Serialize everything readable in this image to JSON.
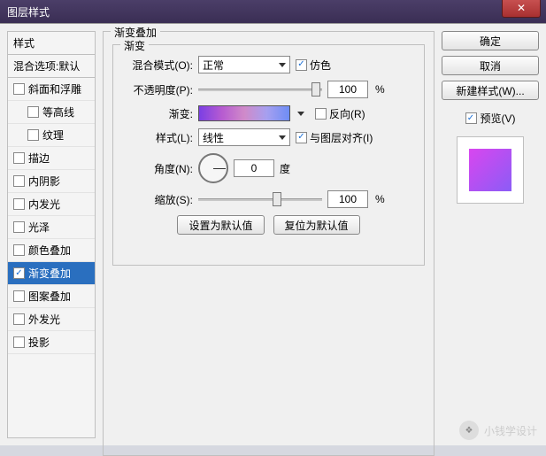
{
  "title": "图层样式",
  "sidebar": {
    "header": "样式",
    "blend": "混合选项:默认",
    "items": [
      {
        "label": "斜面和浮雕",
        "checked": false,
        "selected": false
      },
      {
        "label": "等高线",
        "checked": false,
        "selected": false,
        "indent": true
      },
      {
        "label": "纹理",
        "checked": false,
        "selected": false,
        "indent": true
      },
      {
        "label": "描边",
        "checked": false,
        "selected": false
      },
      {
        "label": "内阴影",
        "checked": false,
        "selected": false
      },
      {
        "label": "内发光",
        "checked": false,
        "selected": false
      },
      {
        "label": "光泽",
        "checked": false,
        "selected": false
      },
      {
        "label": "颜色叠加",
        "checked": false,
        "selected": false
      },
      {
        "label": "渐变叠加",
        "checked": true,
        "selected": true
      },
      {
        "label": "图案叠加",
        "checked": false,
        "selected": false
      },
      {
        "label": "外发光",
        "checked": false,
        "selected": false
      },
      {
        "label": "投影",
        "checked": false,
        "selected": false
      }
    ]
  },
  "main": {
    "group_title": "渐变叠加",
    "inner_title": "渐变",
    "blend_label": "混合模式(O):",
    "blend_value": "正常",
    "dither_label": "仿色",
    "dither_checked": true,
    "opacity_label": "不透明度(P):",
    "opacity_value": "100",
    "pct": "%",
    "gradient_label": "渐变:",
    "reverse_label": "反向(R)",
    "reverse_checked": false,
    "style_label": "样式(L):",
    "style_value": "线性",
    "align_label": "与图层对齐(I)",
    "align_checked": true,
    "angle_label": "角度(N):",
    "angle_value": "0",
    "angle_unit": "度",
    "scale_label": "缩放(S):",
    "scale_value": "100",
    "btn_default": "设置为默认值",
    "btn_reset": "复位为默认值"
  },
  "right": {
    "ok": "确定",
    "cancel": "取消",
    "new_style": "新建样式(W)...",
    "preview_label": "预览(V)",
    "preview_checked": true
  },
  "watermark": "小钱学设计"
}
